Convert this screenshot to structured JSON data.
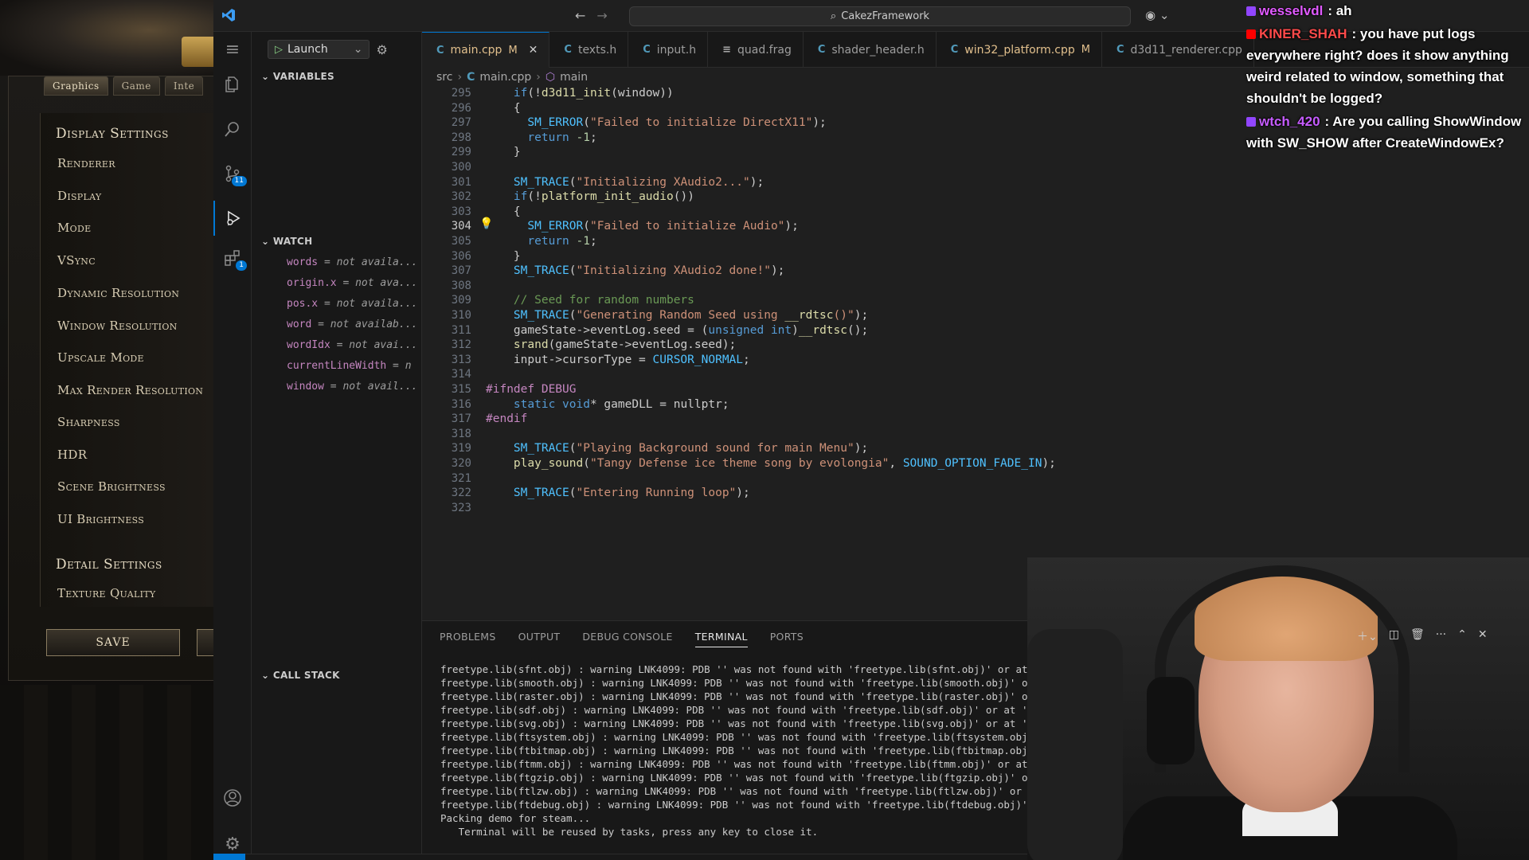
{
  "game": {
    "tabs": [
      "Graphics",
      "Game",
      "Inte"
    ],
    "headers": {
      "display": "Display Settings",
      "detail": "Detail Settings"
    },
    "items": [
      "Renderer",
      "Display",
      "Mode",
      "VSync",
      "Dynamic Resolution",
      "Window Resolution",
      "Upscale Mode",
      "Max Render Resolution",
      "Sharpness",
      "HDR",
      "Scene Brightness",
      "UI Brightness"
    ],
    "detail_items": [
      "Texture Quality"
    ],
    "save_label": "SAVE"
  },
  "titlebar": {
    "search_text": "CakezFramework"
  },
  "activity": {
    "scm_badge": "11",
    "ext_badge": "1"
  },
  "debug": {
    "config": "Launch",
    "variables_label": "VARIABLES",
    "watch_label": "WATCH",
    "callstack_label": "CALL STACK",
    "watch": [
      {
        "name": "words",
        "value": " = not availa..."
      },
      {
        "name": "origin.x",
        "value": " = not ava..."
      },
      {
        "name": "pos.x",
        "value": " = not availa..."
      },
      {
        "name": "word",
        "value": " = not availab..."
      },
      {
        "name": "wordIdx",
        "value": " = not avai..."
      },
      {
        "name": "currentLineWidth",
        "value": " = n"
      },
      {
        "name": "window",
        "value": " = not avail..."
      }
    ]
  },
  "tabs": [
    {
      "icon": "C",
      "label": "main.cpp",
      "mod": "M",
      "active": true
    },
    {
      "icon": "C",
      "label": "texts.h",
      "mod": "",
      "active": false
    },
    {
      "icon": "C",
      "label": "input.h",
      "mod": "",
      "active": false
    },
    {
      "icon": "≡",
      "label": "quad.frag",
      "mod": "",
      "active": false
    },
    {
      "icon": "C",
      "label": "shader_header.h",
      "mod": "",
      "active": false
    },
    {
      "icon": "C",
      "label": "win32_platform.cpp",
      "mod": "M",
      "active": false
    },
    {
      "icon": "C",
      "label": "d3d11_renderer.cpp",
      "mod": "",
      "active": false
    }
  ],
  "breadcrumb": [
    "src",
    "main.cpp",
    "main"
  ],
  "editor": {
    "line_numbers": [
      "295",
      "296",
      "297",
      "298",
      "299",
      "300",
      "301",
      "302",
      "303",
      "304",
      "305",
      "306",
      "307",
      "308",
      "309",
      "310",
      "311",
      "312",
      "313",
      "314",
      "315",
      "316",
      "317",
      "318",
      "319",
      "320",
      "321",
      "322",
      "323"
    ],
    "current_line": "304",
    "lines": [
      "    if(!d3d11_init(window))",
      "    {",
      "      SM_ERROR(\"Failed to initialize DirectX11\");",
      "      return -1;",
      "    }",
      "",
      "    SM_TRACE(\"Initializing XAudio2...\");",
      "    if(!platform_init_audio())",
      "    {",
      "      SM_ERROR(\"Failed to initialize Audio\");",
      "      return -1;",
      "    }",
      "    SM_TRACE(\"Initializing XAudio2 done!\");",
      "",
      "    // Seed for random numbers",
      "    SM_TRACE(\"Generating Random Seed using __rdtsc()\");",
      "    gameState->eventLog.seed = (unsigned int)__rdtsc();",
      "    srand(gameState->eventLog.seed);",
      "    input->cursorType = CURSOR_NORMAL;",
      "",
      "#ifndef DEBUG",
      "    static void* gameDLL = nullptr;",
      "#endif",
      "",
      "    SM_TRACE(\"Playing Background sound for main Menu\");",
      "    play_sound(\"Tangy Defense ice theme song by evolongia\", SOUND_OPTION_FADE_IN);",
      "",
      "    SM_TRACE(\"Entering Running loop\");",
      ""
    ]
  },
  "panel": {
    "tabs": [
      "PROBLEMS",
      "OUTPUT",
      "DEBUG CONSOLE",
      "TERMINAL",
      "PORTS"
    ],
    "terminal_lines": [
      "freetype.lib(sfnt.obj) : warning LNK4099: PDB '' was not found with 'freetype.lib(sfnt.obj)' or at ''; linking object as if",
      "freetype.lib(smooth.obj) : warning LNK4099: PDB '' was not found with 'freetype.lib(smooth.obj)' or at ''; linking object a",
      "freetype.lib(raster.obj) : warning LNK4099: PDB '' was not found with 'freetype.lib(raster.obj)' or at ''; linking object a",
      "freetype.lib(sdf.obj) : warning LNK4099: PDB '' was not found with 'freetype.lib(sdf.obj)' or at ''; linking object as if n",
      "freetype.lib(svg.obj) : warning LNK4099: PDB '' was not found with 'freetype.lib(svg.obj)' or at ''; linking object as if n",
      "freetype.lib(ftsystem.obj) : warning LNK4099: PDB '' was not found with 'freetype.lib(ftsystem.obj)' or at ''; linking obje",
      "freetype.lib(ftbitmap.obj) : warning LNK4099: PDB '' was not found with 'freetype.lib(ftbitmap.obj)' or at ''; linking obj",
      "freetype.lib(ftmm.obj) : warning LNK4099: PDB '' was not found with 'freetype.lib(ftmm.obj)' or at ''; linking object",
      "freetype.lib(ftgzip.obj) : warning LNK4099: PDB '' was not found with 'freetype.lib(ftgzip.obj)' or at ''; linking ob",
      "freetype.lib(ftlzw.obj) : warning LNK4099: PDB '' was not found with 'freetype.lib(ftlzw.obj)' or at ''; linking",
      "freetype.lib(ftdebug.obj) : warning LNK4099: PDB '' was not found with 'freetype.lib(ftdebug.obj)' or at ''; li",
      "Packing demo for steam...",
      "   Terminal will be reused by tasks, press any key to close it."
    ]
  },
  "chat": [
    {
      "user": "wesselvdl",
      "text": ": ah",
      "color": "#e05aff",
      "icon_color": "#9146ff"
    },
    {
      "user": "KINER_SHAH",
      "text": ": you have put logs everywhere right? does it show anything weird related to window, something that shouldn't be logged?",
      "color": "#ff4a4a",
      "icon_color": "#ff0000"
    },
    {
      "user": "wtch_420",
      "text": ": Are you calling ShowWindow with SW_SHOW after CreateWindowEx?",
      "color": "#c65cff",
      "icon_color": "#9146ff"
    }
  ],
  "colors": {
    "accent": "#0078d4",
    "editor_bg": "#1f1f1f",
    "sidebar_bg": "#181818"
  }
}
